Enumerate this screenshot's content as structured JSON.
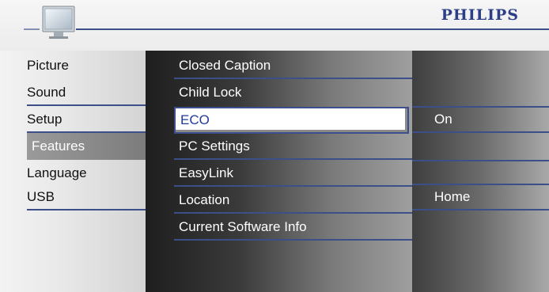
{
  "header": {
    "brand": "PHILIPS",
    "tv_icon": "tv-icon"
  },
  "menu": {
    "categories": [
      {
        "label": "Picture",
        "selected": false
      },
      {
        "label": "Sound",
        "selected": false
      },
      {
        "label": "Setup",
        "selected": false
      },
      {
        "label": "Features",
        "selected": true
      },
      {
        "label": "Language",
        "selected": false
      },
      {
        "label": "USB",
        "selected": false
      }
    ],
    "features": [
      {
        "label": "Closed Caption",
        "highlighted": false
      },
      {
        "label": "Child Lock",
        "highlighted": false
      },
      {
        "label": "ECO",
        "highlighted": true
      },
      {
        "label": "PC Settings",
        "highlighted": false
      },
      {
        "label": "EasyLink",
        "highlighted": false
      },
      {
        "label": "Location",
        "highlighted": false
      },
      {
        "label": "Current Software Info",
        "highlighted": false
      }
    ],
    "values": {
      "eco": "On",
      "location": "Home"
    }
  },
  "colors": {
    "accent": "#3c4f8a",
    "brand": "#2c3f86",
    "highlight_text": "#1f3a9a"
  }
}
